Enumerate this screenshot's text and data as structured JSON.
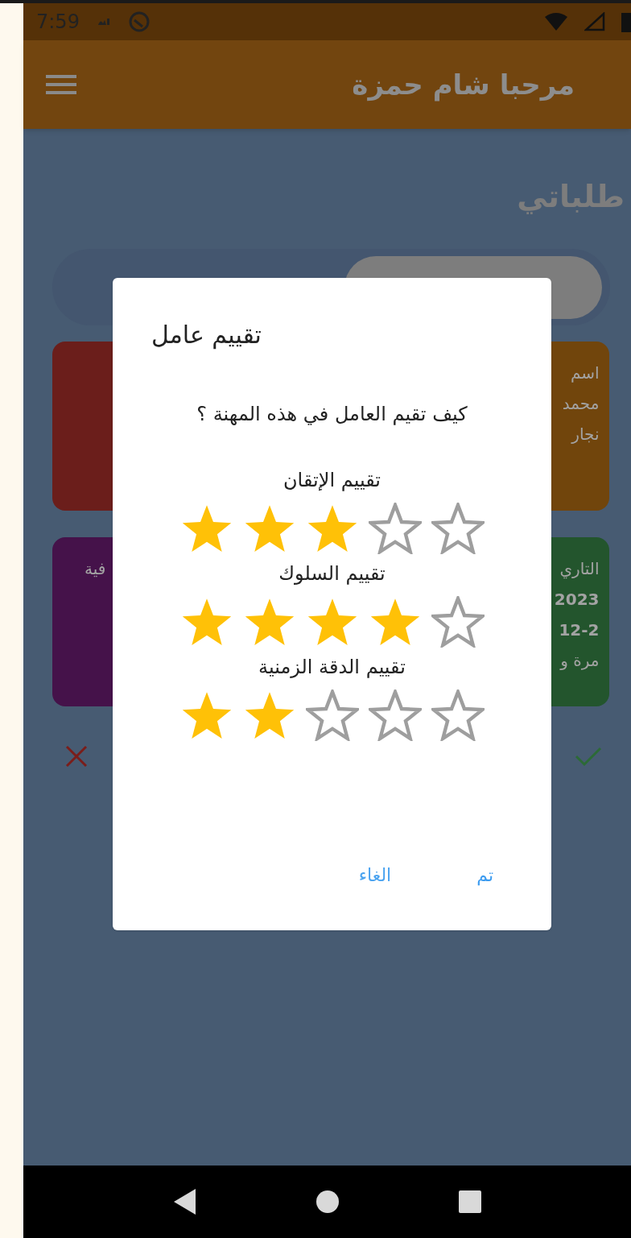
{
  "status_bar": {
    "time": "7:59"
  },
  "app_bar": {
    "title": "مرحبا شام حمزة"
  },
  "page": {
    "heading": "طلباتي"
  },
  "cards": [
    {
      "color": "#6b1e1b"
    },
    {
      "color": "#71450c",
      "lines": [
        "اسم",
        "محمد",
        "نجار"
      ]
    },
    {
      "color": "#45124a",
      "lines": [
        "فية"
      ]
    },
    {
      "color": "#23552d",
      "lines": [
        "التاري",
        "2023",
        "12-2",
        "مرة و"
      ]
    }
  ],
  "dialog": {
    "title": "تقييم عامل",
    "question": "كيف تقيم العامل في هذه المهنة ؟",
    "ratings": [
      {
        "label": "تقييم الإتقان",
        "stars": 3
      },
      {
        "label": "تقييم السلوك",
        "stars": 4
      },
      {
        "label": "تقييم الدقة الزمنية",
        "stars": 2
      }
    ],
    "buttons": [
      {
        "kind": "confirm",
        "label": "تم"
      },
      {
        "kind": "cancel",
        "label": "الغاء"
      }
    ]
  }
}
